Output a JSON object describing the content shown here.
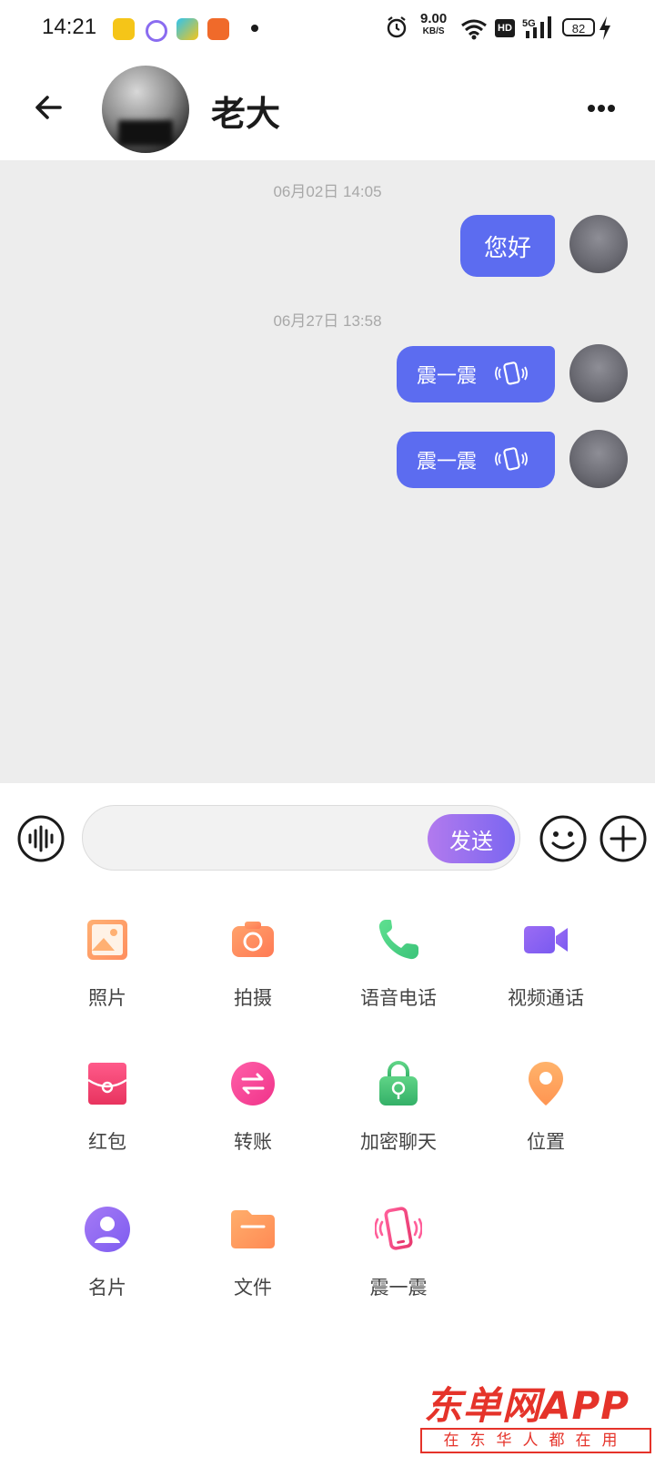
{
  "status_bar": {
    "time": "14:21",
    "net_speed": "9.00",
    "net_unit": "KB/S",
    "hd": "HD",
    "signal": "5G",
    "battery": "82"
  },
  "header": {
    "contact_name": "老大"
  },
  "messages": [
    {
      "timestamp": "06月02日 14:05"
    },
    {
      "text": "您好"
    },
    {
      "timestamp": "06月27日 13:58"
    },
    {
      "text": "震一震"
    },
    {
      "text": "震一震"
    }
  ],
  "input": {
    "placeholder": "",
    "send_label": "发送"
  },
  "tools": [
    {
      "label": "照片",
      "icon": "photo-icon"
    },
    {
      "label": "拍摄",
      "icon": "camera-icon"
    },
    {
      "label": "语音电话",
      "icon": "phone-icon"
    },
    {
      "label": "视频通话",
      "icon": "video-icon"
    },
    {
      "label": "红包",
      "icon": "red-packet-icon"
    },
    {
      "label": "转账",
      "icon": "transfer-icon"
    },
    {
      "label": "加密聊天",
      "icon": "lock-icon"
    },
    {
      "label": "位置",
      "icon": "location-icon"
    },
    {
      "label": "名片",
      "icon": "contact-card-icon"
    },
    {
      "label": "文件",
      "icon": "folder-icon"
    },
    {
      "label": "震一震",
      "icon": "shake-phone-icon"
    }
  ],
  "watermark": {
    "title": "东单网APP",
    "subtitle": "在东华人都在用"
  },
  "colors": {
    "bubble": "#5c6cf0",
    "chat_bg": "#ededed",
    "send_gradient_start": "#b27aee",
    "send_gradient_end": "#7b66f0"
  }
}
